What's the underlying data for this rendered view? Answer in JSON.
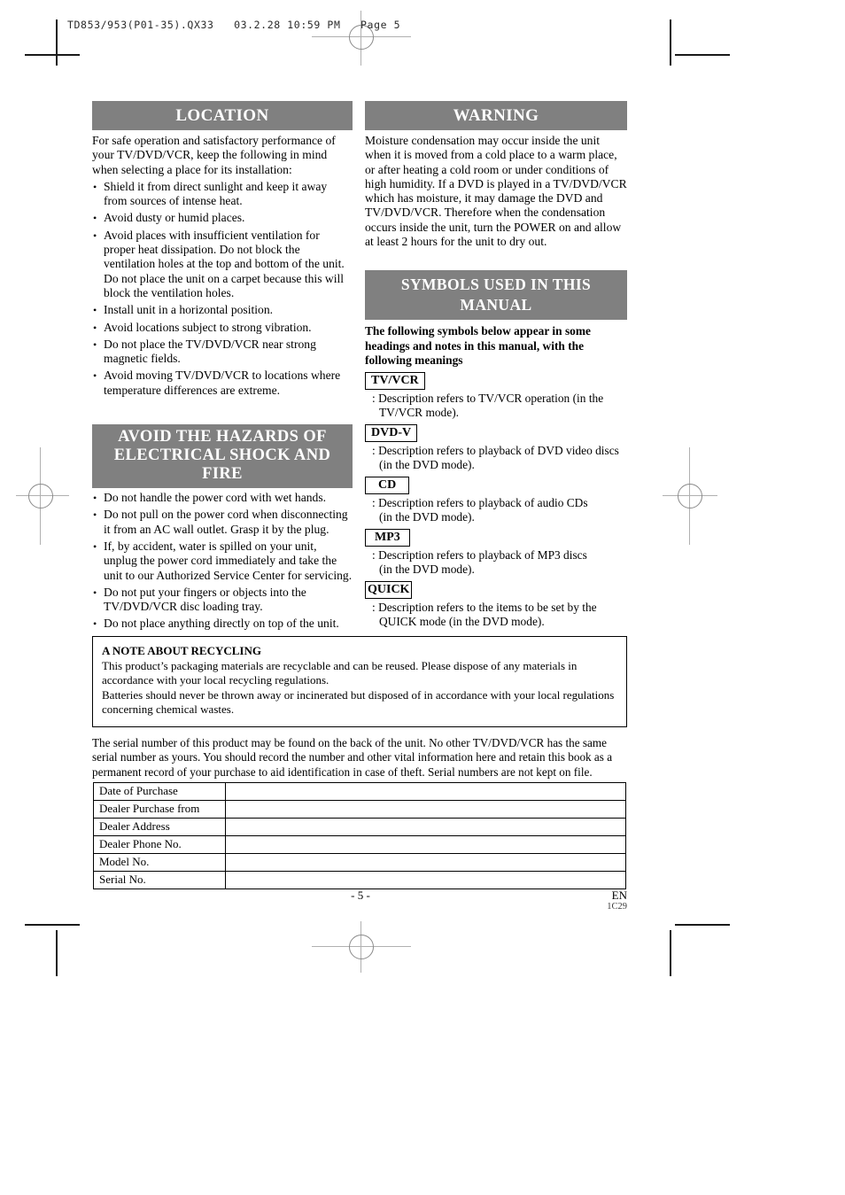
{
  "file_header": "TD853/953(P01-35).QX33   03.2.28 10:59 PM   Page 5",
  "sections": {
    "location": {
      "heading": "LOCATION",
      "intro": "For safe operation and satisfactory performance of your TV/DVD/VCR, keep the following in mind when selecting a place for its installation:",
      "bullets": [
        "Shield it from direct sunlight and keep it away from sources of intense heat.",
        "Avoid dusty or humid places.",
        "Avoid places with insufficient ventilation for proper heat dissipation. Do not block the ventilation holes at the top and bottom of the unit. Do not place the unit on a carpet because this will block the ventilation holes.",
        "Install unit in a horizontal position.",
        "Avoid locations subject to strong vibration.",
        "Do not place the TV/DVD/VCR near strong magnetic fields.",
        "Avoid moving TV/DVD/VCR to locations where temperature differences are extreme."
      ]
    },
    "hazards": {
      "heading_line1": "AVOID THE HAZARDS OF",
      "heading_line2": "ELECTRICAL SHOCK AND FIRE",
      "bullets": [
        "Do not handle the power cord with wet hands.",
        "Do not pull on the power cord when disconnecting it from an AC wall outlet. Grasp it by the plug.",
        "If, by accident, water is spilled on your unit, unplug the power cord immediately and take the unit to our Authorized Service Center for servicing.",
        "Do not put your fingers or objects into the TV/DVD/VCR disc loading tray.",
        "Do not place anything directly on top of the unit."
      ]
    },
    "warning": {
      "heading": "WARNING",
      "body": "Moisture condensation may occur inside the unit when it is moved from a cold place to a warm place, or after heating a cold room or under conditions of high humidity. If a DVD is played in a TV/DVD/VCR which has moisture, it may damage the DVD and TV/DVD/VCR. Therefore when the condensation occurs inside the unit, turn the POWER on and allow at least 2 hours for the unit to dry out."
    },
    "symbols": {
      "heading": "SYMBOLS USED IN THIS MANUAL",
      "intro": "The following symbols below appear in some headings and notes in this manual, with the following meanings",
      "items": [
        {
          "tag": "TV/VCR",
          "desc_line1": ": Description refers to TV/VCR operation (in the",
          "desc_line2": "TV/VCR mode)."
        },
        {
          "tag": "DVD-V",
          "desc_line1": ": Description refers to playback of DVD video discs",
          "desc_line2": "(in the DVD mode)."
        },
        {
          "tag": "CD",
          "desc_line1": ": Description refers to playback of audio CDs",
          "desc_line2": "(in the DVD mode)."
        },
        {
          "tag": "MP3",
          "desc_line1": ": Description refers to playback of  MP3 discs",
          "desc_line2": "(in the DVD mode)."
        },
        {
          "tag": "QUICK",
          "desc_line1": ": Description refers to the items to be set by the",
          "desc_line2": "QUICK mode (in the DVD mode)."
        }
      ]
    },
    "recycling": {
      "title": "A NOTE ABOUT RECYCLING",
      "paragraph1": "This product’s packaging materials are recyclable and can be reused. Please dispose of any materials in accordance with your local recycling regulations.",
      "paragraph2": "Batteries should never be thrown away or incinerated but disposed of in accordance with your local regulations concerning chemical wastes."
    },
    "serial_note": "The serial number of this product may be found on the back of the unit. No other TV/DVD/VCR has the same serial number as yours. You should record the number and other vital information here and retain this book as a permanent record of your purchase to aid identification in case of theft. Serial numbers are not kept on file.",
    "record_table": {
      "rows": [
        {
          "label": "Date of Purchase",
          "value": ""
        },
        {
          "label": "Dealer Purchase from",
          "value": ""
        },
        {
          "label": "Dealer Address",
          "value": ""
        },
        {
          "label": "Dealer Phone No.",
          "value": ""
        },
        {
          "label": "Model No.",
          "value": ""
        },
        {
          "label": "Serial No.",
          "value": ""
        }
      ]
    }
  },
  "footer": {
    "page_number": "- 5 -",
    "language": "EN",
    "code": "1C29"
  },
  "colors": {
    "heading_bar": "#808080",
    "heading_text": "#ffffff",
    "text": "#000000",
    "crop_mark": "#1a1a1a",
    "reg_mark": "#8a8a8a"
  }
}
